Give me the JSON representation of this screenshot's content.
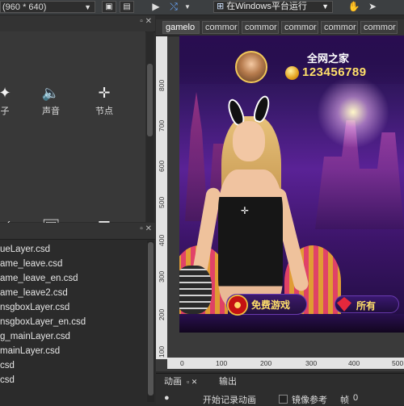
{
  "toolbar": {
    "resolution_label": "(960 * 640)",
    "run_target_label": "在Windows平台运行",
    "icons": [
      "play-icon",
      "publish-icon",
      "windows-icon",
      "hand-tool-icon",
      "pointer-tool-icon"
    ]
  },
  "components": {
    "row1": [
      "子",
      "声音",
      "节点"
    ],
    "icons_row1": [
      "sparkle-icon",
      "speaker-icon",
      "node-crosshair-icon"
    ],
    "icons_row2": [
      "slider-icon",
      "image-icon",
      "text-area-icon"
    ]
  },
  "files": [
    "ueLayer.csd",
    "ame_leave.csd",
    "ame_leave_en.csd",
    "ame_leave2.csd",
    "nsgboxLayer.csd",
    "nsgboxLayer_en.csd",
    "g_mainLayer.csd",
    "mainLayer.csd",
    "csd",
    "csd"
  ],
  "tabs": [
    "gamelo",
    "commor",
    "commor",
    "commor",
    "commor",
    "commor"
  ],
  "ruler": {
    "v_labels": [
      "800",
      "700",
      "600",
      "500",
      "400",
      "300",
      "200",
      "100"
    ],
    "h_labels": [
      "0",
      "100",
      "200",
      "300",
      "400",
      "500"
    ]
  },
  "game": {
    "player_name": "全网之家",
    "coins": "123456789",
    "free_play_label": "免费游戏",
    "all_label": "所有"
  },
  "bottom_panel": {
    "tab_animation": "动画",
    "tab_output": "输出",
    "record_label": "开始记录动画",
    "mirror_label": "镜像参考",
    "frame_label": "帧",
    "frame_value": "0"
  },
  "colors": {
    "toolbar_bg": "#3c3f41",
    "panel_bg": "#2b2b2b",
    "coin_gold": "#ffe06a",
    "game_purple": "#3b1a6e"
  }
}
